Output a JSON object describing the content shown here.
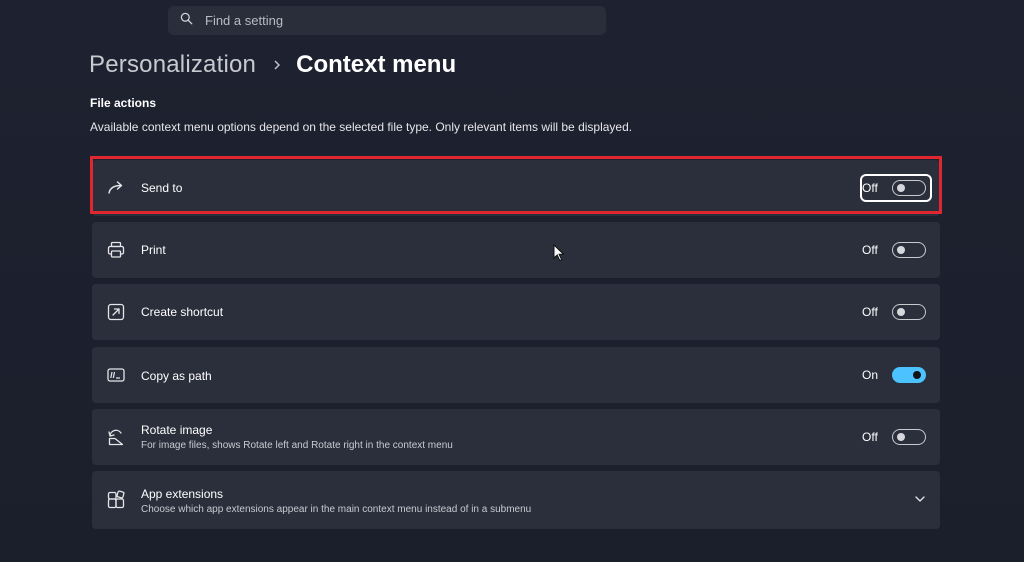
{
  "search": {
    "placeholder": "Find a setting",
    "icon": "search-icon"
  },
  "breadcrumb": {
    "parent": "Personalization",
    "current": "Context menu",
    "separator_icon": "chevron-right-icon"
  },
  "section": {
    "title": "File actions",
    "description": "Available context menu options depend on the selected file type. Only relevant items will be displayed."
  },
  "rows": [
    {
      "icon": "share-arrow-icon",
      "label": "Send to",
      "sublabel": "",
      "state_text": "Off",
      "on": false,
      "highlighted": true
    },
    {
      "icon": "printer-icon",
      "label": "Print",
      "sublabel": "",
      "state_text": "Off",
      "on": false,
      "highlighted": false
    },
    {
      "icon": "shortcut-icon",
      "label": "Create shortcut",
      "sublabel": "",
      "state_text": "Off",
      "on": false,
      "highlighted": false
    },
    {
      "icon": "copy-path-icon",
      "label": "Copy as path",
      "sublabel": "",
      "state_text": "On",
      "on": true,
      "highlighted": false
    },
    {
      "icon": "rotate-icon",
      "label": "Rotate image",
      "sublabel": "For image files, shows Rotate left and Rotate right in the context menu",
      "state_text": "Off",
      "on": false,
      "highlighted": false
    },
    {
      "icon": "apps-icon",
      "label": "App extensions",
      "sublabel": "Choose which app extensions appear in the main context menu instead of in a submenu",
      "expandable": true
    }
  ],
  "colors": {
    "accent": "#4cc2ff",
    "highlight": "#e0262f",
    "card": "#2b2f3b",
    "background": "#1b1f2c"
  }
}
